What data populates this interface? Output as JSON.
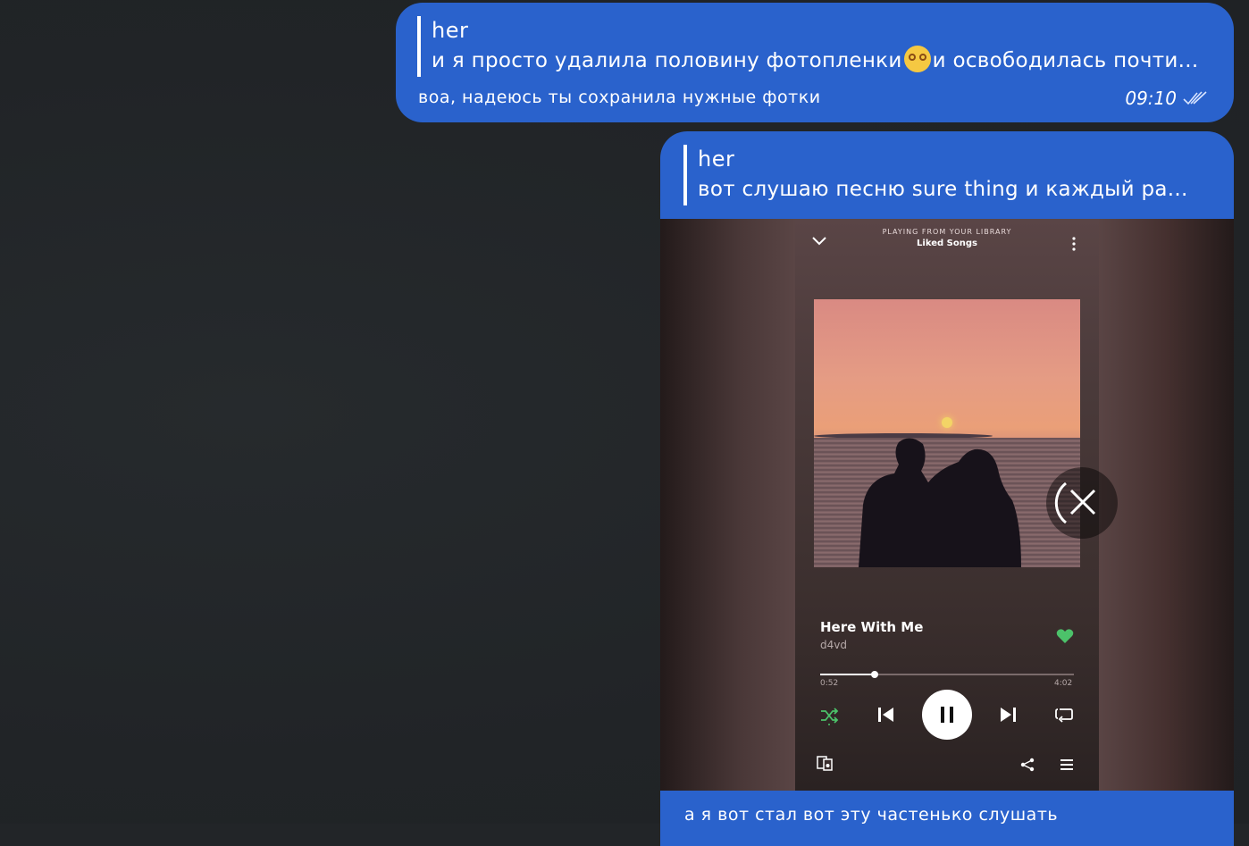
{
  "messages": [
    {
      "reply_author": "her",
      "reply_text_before_emoji": "и я просто удалила половину фотопленки",
      "reply_text_after_emoji": "и освободилась почти...",
      "reply_emoji": "woozy-face-emoji",
      "text": "воа, надеюсь ты сохранила нужные фотки",
      "time": "09:10",
      "status_icon": "double-check-icon"
    },
    {
      "reply_author": "her",
      "reply_text": "вот слушаю песню sure thing и каждый ра...",
      "text": "а я вот стал вот эту частенько слушать"
    }
  ],
  "player": {
    "playing_from": "PLAYING FROM YOUR LIBRARY",
    "playlist": "Liked Songs",
    "song_title": "Here With Me",
    "artist": "d4vd",
    "elapsed": "0:52",
    "total": "4:02",
    "progress_fraction": 0.215,
    "liked": true,
    "accent_color": "#4cc26a",
    "download_overlay_icon": "cancel-download-icon"
  },
  "colors": {
    "bubble": "#2a62cc",
    "background": "#222528"
  }
}
